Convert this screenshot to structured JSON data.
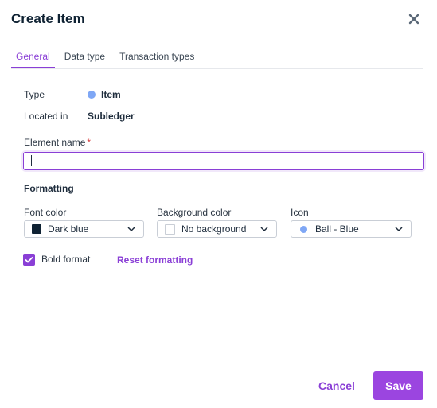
{
  "dialog": {
    "title": "Create Item",
    "close_icon": "close-icon"
  },
  "tabs": [
    {
      "label": "General",
      "active": true
    },
    {
      "label": "Data type",
      "active": false
    },
    {
      "label": "Transaction types",
      "active": false
    }
  ],
  "info": {
    "type_label": "Type",
    "type_value": "Item",
    "type_dot_color": "#7fa7f5",
    "located_label": "Located in",
    "located_value": "Subledger"
  },
  "element_name": {
    "label": "Element name",
    "required_mark": "*",
    "value": ""
  },
  "formatting": {
    "title": "Formatting",
    "font_color": {
      "label": "Font color",
      "value": "Dark blue",
      "swatch": "#0f2233"
    },
    "background_color": {
      "label": "Background color",
      "value": "No background",
      "swatch": "#ffffff"
    },
    "icon": {
      "label": "Icon",
      "value": "Ball - Blue",
      "dot_color": "#7fa7f5"
    },
    "bold_format": {
      "label": "Bold format",
      "checked": true
    },
    "reset_label": "Reset formatting"
  },
  "footer": {
    "cancel_label": "Cancel",
    "save_label": "Save"
  },
  "colors": {
    "accent": "#8a3fd6",
    "save_button": "#9b45e0"
  }
}
